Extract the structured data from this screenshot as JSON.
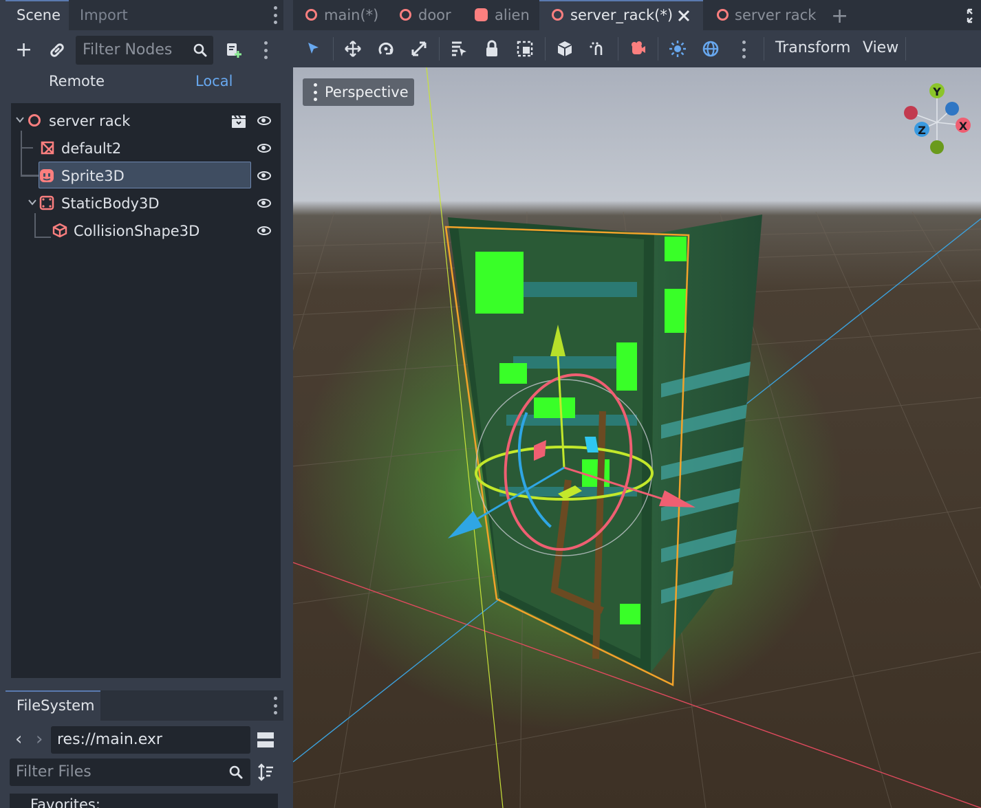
{
  "scene_dock": {
    "tabs": [
      "Scene",
      "Import"
    ],
    "filter_placeholder": "Filter Nodes",
    "modes": [
      "Remote",
      "Local"
    ],
    "tree": [
      {
        "label": "server rack",
        "icon": "node3d-icon"
      },
      {
        "label": "default2",
        "icon": "mesh-instance-icon"
      },
      {
        "label": "Sprite3D",
        "icon": "sprite3d-icon"
      },
      {
        "label": "StaticBody3D",
        "icon": "static-body-icon"
      },
      {
        "label": "CollisionShape3D",
        "icon": "collision-shape-icon"
      }
    ]
  },
  "filesystem_dock": {
    "tab": "FileSystem",
    "path": "res://main.exr",
    "filter_placeholder": "Filter Files",
    "favorites_label": "Favorites:"
  },
  "editor_tabs": [
    {
      "label": "main(*)",
      "icon": "node3d-icon"
    },
    {
      "label": "door",
      "icon": "node3d-icon"
    },
    {
      "label": "alien",
      "icon": "sprite3d-icon"
    },
    {
      "label": "server_rack(*)",
      "icon": "node3d-icon",
      "active": true
    },
    {
      "label": "server rack",
      "icon": "node3d-icon"
    }
  ],
  "toolbar": {
    "menus": [
      "Transform",
      "View"
    ]
  },
  "viewport": {
    "mode_button": "Perspective",
    "gizmo_axes": [
      "Y",
      "X",
      "Z"
    ]
  },
  "colors": {
    "accent": "#68a8ef",
    "node3d": "#fc7f7f",
    "selection_outline": "#f2a32a"
  }
}
